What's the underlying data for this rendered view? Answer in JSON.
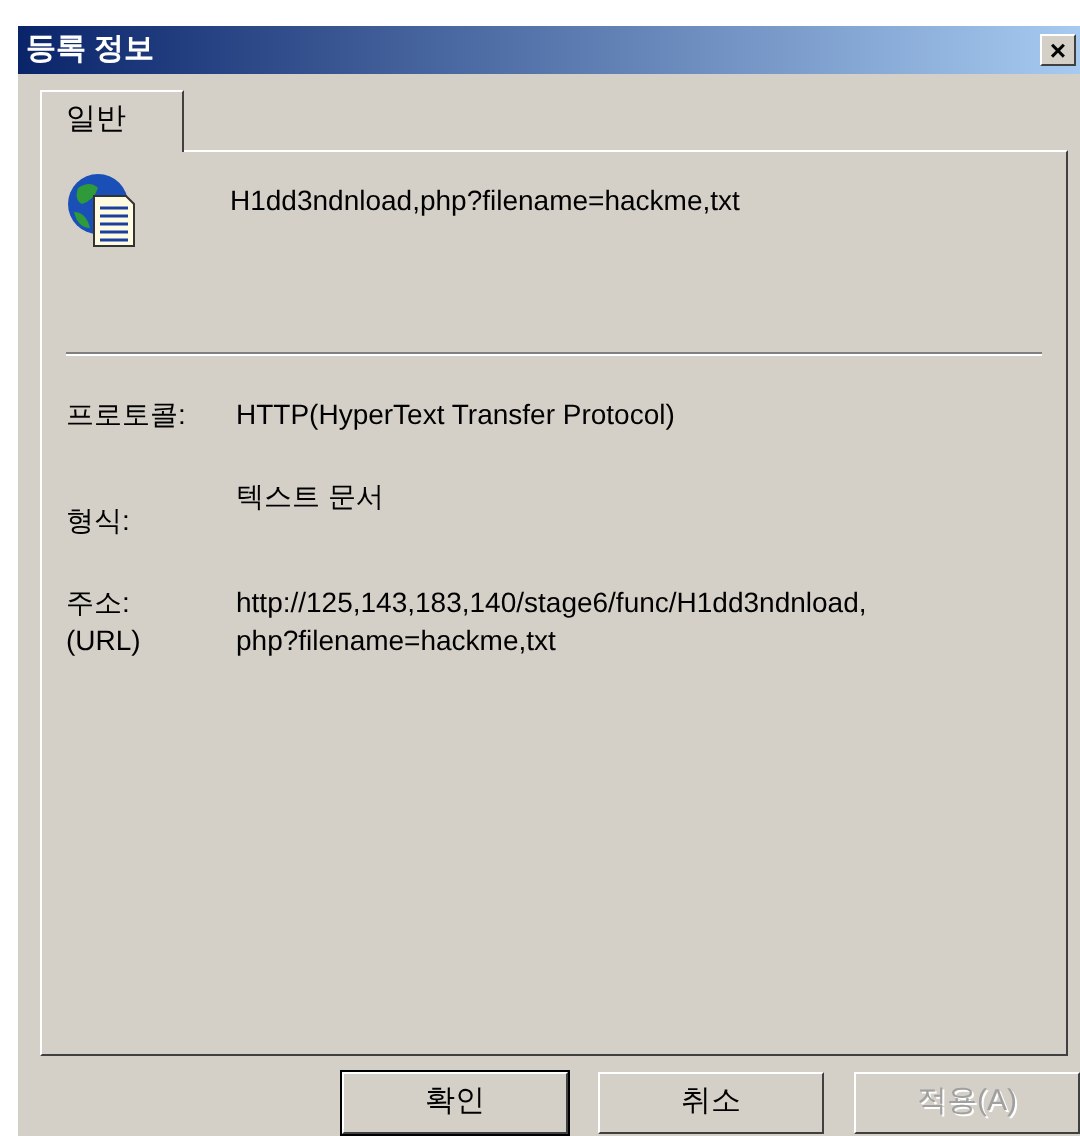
{
  "window": {
    "title": "등록 정보",
    "close": "×"
  },
  "tabs": [
    {
      "label": "일반",
      "selected": true
    }
  ],
  "file_name": "H1dd3ndnload,php?filename=hackme,txt",
  "fields": [
    {
      "label": "프로토콜:",
      "value": "HTTP(HyperText Transfer Protocol)"
    },
    {
      "label": "형식:",
      "value": "텍스트 문서"
    },
    {
      "label": "주소:\n(URL)",
      "value": "http://125,143,183,140/stage6/func/H1dd3ndnload,\nphp?filename=hackme,txt"
    }
  ],
  "buttons": [
    {
      "label": "확인",
      "default": true,
      "disabled": false
    },
    {
      "label": "취소",
      "default": false,
      "disabled": false
    },
    {
      "label": "적용(A)",
      "default": false,
      "disabled": true
    }
  ]
}
